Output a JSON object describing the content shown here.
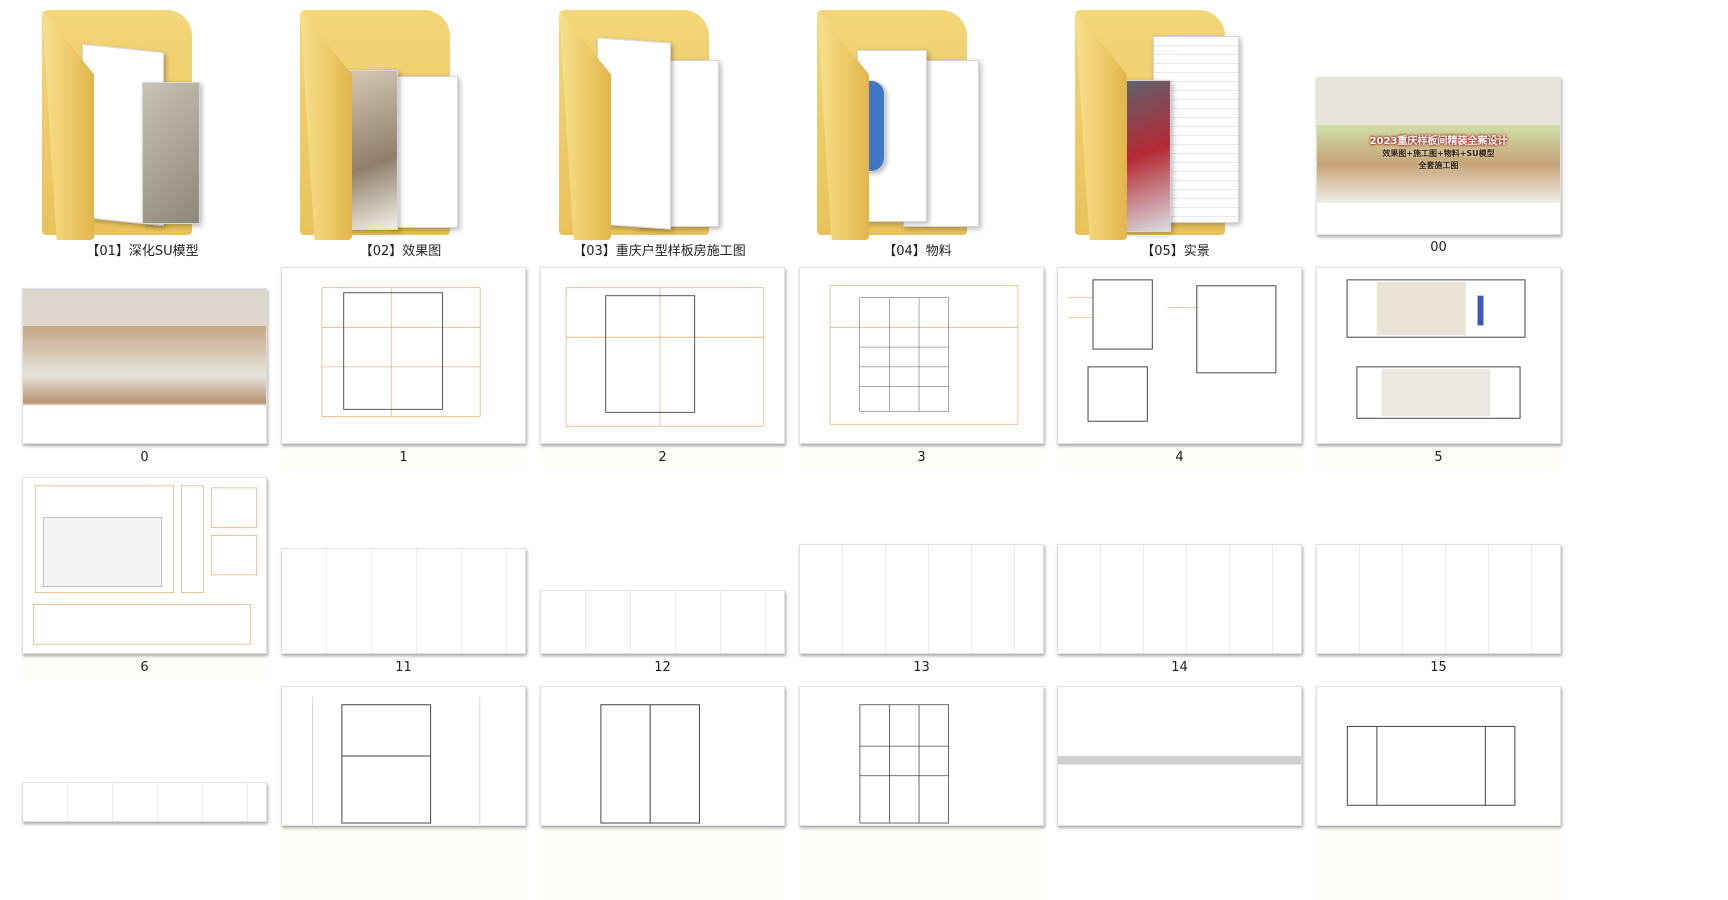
{
  "folders": [
    {
      "label": "【01】深化SU模型",
      "icon": "folder-icon"
    },
    {
      "label": "【02】效果图",
      "icon": "folder-icon"
    },
    {
      "label": "【03】重庆户型样板房施工图",
      "icon": "folder-icon"
    },
    {
      "label": "【04】物料",
      "icon": "folder-icon"
    },
    {
      "label": "【05】实景",
      "icon": "folder-icon"
    }
  ],
  "files": [
    {
      "label": "00",
      "cover_text": [
        "2023重庆样板间精装全案设计",
        "效果图+施工图+物料+SU模型",
        "全套施工图"
      ]
    },
    {
      "label": "0"
    },
    {
      "label": "1"
    },
    {
      "label": "2"
    },
    {
      "label": "3"
    },
    {
      "label": "4"
    },
    {
      "label": "5"
    },
    {
      "label": "6"
    },
    {
      "label": "11"
    },
    {
      "label": "12"
    },
    {
      "label": "13"
    },
    {
      "label": "14"
    },
    {
      "label": "15"
    },
    {
      "label": ""
    },
    {
      "label": ""
    },
    {
      "label": ""
    },
    {
      "label": ""
    },
    {
      "label": ""
    },
    {
      "label": ""
    }
  ],
  "colors": {
    "folder": "#eec65f",
    "cad_line": "#e89a4a",
    "background": "#ffffff"
  }
}
